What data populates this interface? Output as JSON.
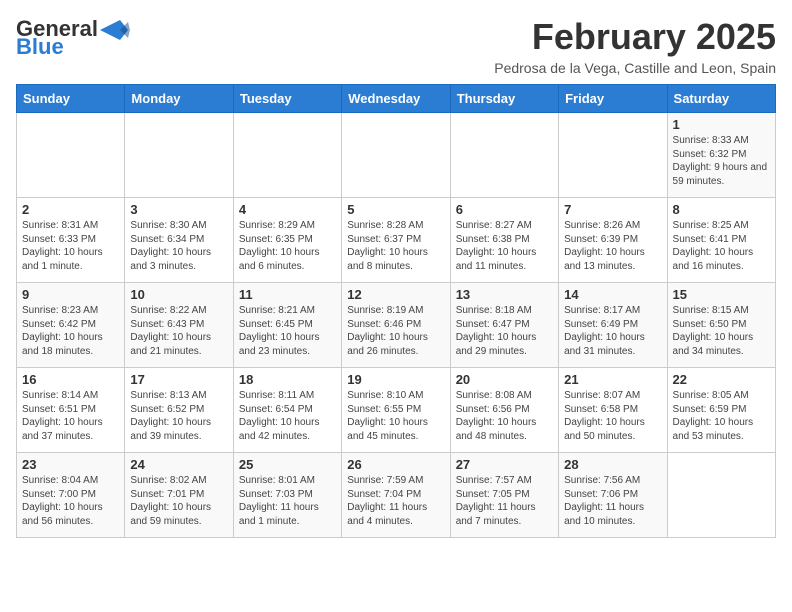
{
  "header": {
    "logo_general": "General",
    "logo_blue": "Blue",
    "month": "February 2025",
    "location": "Pedrosa de la Vega, Castille and Leon, Spain"
  },
  "weekdays": [
    "Sunday",
    "Monday",
    "Tuesday",
    "Wednesday",
    "Thursday",
    "Friday",
    "Saturday"
  ],
  "weeks": [
    [
      {
        "day": "",
        "info": ""
      },
      {
        "day": "",
        "info": ""
      },
      {
        "day": "",
        "info": ""
      },
      {
        "day": "",
        "info": ""
      },
      {
        "day": "",
        "info": ""
      },
      {
        "day": "",
        "info": ""
      },
      {
        "day": "1",
        "info": "Sunrise: 8:33 AM\nSunset: 6:32 PM\nDaylight: 9 hours and 59 minutes."
      }
    ],
    [
      {
        "day": "2",
        "info": "Sunrise: 8:31 AM\nSunset: 6:33 PM\nDaylight: 10 hours and 1 minute."
      },
      {
        "day": "3",
        "info": "Sunrise: 8:30 AM\nSunset: 6:34 PM\nDaylight: 10 hours and 3 minutes."
      },
      {
        "day": "4",
        "info": "Sunrise: 8:29 AM\nSunset: 6:35 PM\nDaylight: 10 hours and 6 minutes."
      },
      {
        "day": "5",
        "info": "Sunrise: 8:28 AM\nSunset: 6:37 PM\nDaylight: 10 hours and 8 minutes."
      },
      {
        "day": "6",
        "info": "Sunrise: 8:27 AM\nSunset: 6:38 PM\nDaylight: 10 hours and 11 minutes."
      },
      {
        "day": "7",
        "info": "Sunrise: 8:26 AM\nSunset: 6:39 PM\nDaylight: 10 hours and 13 minutes."
      },
      {
        "day": "8",
        "info": "Sunrise: 8:25 AM\nSunset: 6:41 PM\nDaylight: 10 hours and 16 minutes."
      }
    ],
    [
      {
        "day": "9",
        "info": "Sunrise: 8:23 AM\nSunset: 6:42 PM\nDaylight: 10 hours and 18 minutes."
      },
      {
        "day": "10",
        "info": "Sunrise: 8:22 AM\nSunset: 6:43 PM\nDaylight: 10 hours and 21 minutes."
      },
      {
        "day": "11",
        "info": "Sunrise: 8:21 AM\nSunset: 6:45 PM\nDaylight: 10 hours and 23 minutes."
      },
      {
        "day": "12",
        "info": "Sunrise: 8:19 AM\nSunset: 6:46 PM\nDaylight: 10 hours and 26 minutes."
      },
      {
        "day": "13",
        "info": "Sunrise: 8:18 AM\nSunset: 6:47 PM\nDaylight: 10 hours and 29 minutes."
      },
      {
        "day": "14",
        "info": "Sunrise: 8:17 AM\nSunset: 6:49 PM\nDaylight: 10 hours and 31 minutes."
      },
      {
        "day": "15",
        "info": "Sunrise: 8:15 AM\nSunset: 6:50 PM\nDaylight: 10 hours and 34 minutes."
      }
    ],
    [
      {
        "day": "16",
        "info": "Sunrise: 8:14 AM\nSunset: 6:51 PM\nDaylight: 10 hours and 37 minutes."
      },
      {
        "day": "17",
        "info": "Sunrise: 8:13 AM\nSunset: 6:52 PM\nDaylight: 10 hours and 39 minutes."
      },
      {
        "day": "18",
        "info": "Sunrise: 8:11 AM\nSunset: 6:54 PM\nDaylight: 10 hours and 42 minutes."
      },
      {
        "day": "19",
        "info": "Sunrise: 8:10 AM\nSunset: 6:55 PM\nDaylight: 10 hours and 45 minutes."
      },
      {
        "day": "20",
        "info": "Sunrise: 8:08 AM\nSunset: 6:56 PM\nDaylight: 10 hours and 48 minutes."
      },
      {
        "day": "21",
        "info": "Sunrise: 8:07 AM\nSunset: 6:58 PM\nDaylight: 10 hours and 50 minutes."
      },
      {
        "day": "22",
        "info": "Sunrise: 8:05 AM\nSunset: 6:59 PM\nDaylight: 10 hours and 53 minutes."
      }
    ],
    [
      {
        "day": "23",
        "info": "Sunrise: 8:04 AM\nSunset: 7:00 PM\nDaylight: 10 hours and 56 minutes."
      },
      {
        "day": "24",
        "info": "Sunrise: 8:02 AM\nSunset: 7:01 PM\nDaylight: 10 hours and 59 minutes."
      },
      {
        "day": "25",
        "info": "Sunrise: 8:01 AM\nSunset: 7:03 PM\nDaylight: 11 hours and 1 minute."
      },
      {
        "day": "26",
        "info": "Sunrise: 7:59 AM\nSunset: 7:04 PM\nDaylight: 11 hours and 4 minutes."
      },
      {
        "day": "27",
        "info": "Sunrise: 7:57 AM\nSunset: 7:05 PM\nDaylight: 11 hours and 7 minutes."
      },
      {
        "day": "28",
        "info": "Sunrise: 7:56 AM\nSunset: 7:06 PM\nDaylight: 11 hours and 10 minutes."
      },
      {
        "day": "",
        "info": ""
      }
    ]
  ]
}
